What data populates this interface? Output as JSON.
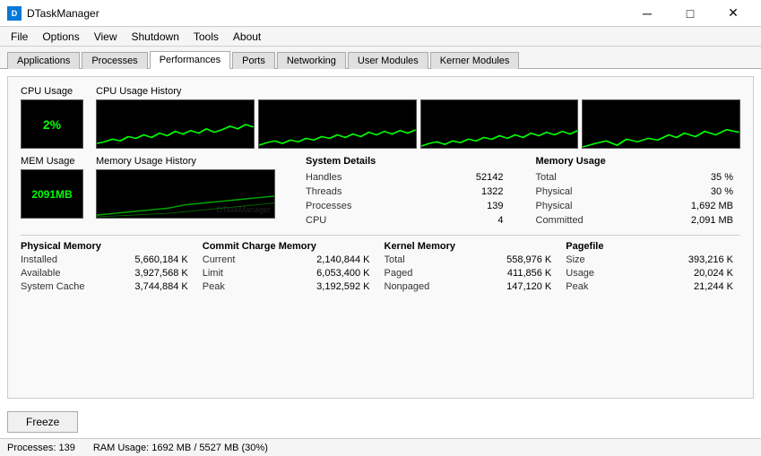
{
  "titlebar": {
    "icon_label": "D",
    "title": "DTaskManager",
    "minimize_label": "─",
    "maximize_label": "□",
    "close_label": "✕"
  },
  "menubar": {
    "items": [
      "File",
      "Options",
      "View",
      "Shutdown",
      "Tools",
      "About"
    ]
  },
  "tabs": {
    "items": [
      "Applications",
      "Processes",
      "Performances",
      "Ports",
      "Networking",
      "User Modules",
      "Kerner Modules"
    ],
    "active": "Performances"
  },
  "cpu": {
    "section_label": "CPU Usage",
    "value": "2%",
    "history_label": "CPU Usage History"
  },
  "mem": {
    "section_label": "MEM Usage",
    "value": "2091MB",
    "history_label": "Memory Usage History"
  },
  "system_details": {
    "title": "System Details",
    "rows": [
      {
        "label": "Handles",
        "value": "52142"
      },
      {
        "label": "Threads",
        "value": "1322"
      },
      {
        "label": "Processes",
        "value": "139"
      },
      {
        "label": "CPU",
        "value": "4"
      }
    ]
  },
  "memory_usage": {
    "title": "Memory Usage",
    "rows": [
      {
        "label": "Total",
        "value": "35 %"
      },
      {
        "label": "Physical",
        "value": "30 %"
      },
      {
        "label": "Physical",
        "value": "1,692 MB"
      },
      {
        "label": "Committed",
        "value": "2,091 MB"
      }
    ]
  },
  "physical_memory": {
    "title": "Physical Memory",
    "rows": [
      {
        "label": "Installed",
        "value": "5,660,184 K"
      },
      {
        "label": "Available",
        "value": "3,927,568 K"
      },
      {
        "label": "System Cache",
        "value": "3,744,884 K"
      }
    ]
  },
  "commit_charge": {
    "title": "Commit Charge Memory",
    "rows": [
      {
        "label": "Current",
        "value": "2,140,844 K"
      },
      {
        "label": "Limit",
        "value": "6,053,400 K"
      },
      {
        "label": "Peak",
        "value": "3,192,592 K"
      }
    ]
  },
  "kernel_memory": {
    "title": "Kernel Memory",
    "rows": [
      {
        "label": "Total",
        "value": "558,976 K"
      },
      {
        "label": "Paged",
        "value": "411,856 K"
      },
      {
        "label": "Nonpaged",
        "value": "147,120 K"
      }
    ]
  },
  "pagefile": {
    "title": "Pagefile",
    "rows": [
      {
        "label": "Size",
        "value": "393,216 K"
      },
      {
        "label": "Usage",
        "value": "20,024 K"
      },
      {
        "label": "Peak",
        "value": "21,244 K"
      }
    ]
  },
  "freeze_button": "Freeze",
  "statusbar": {
    "processes": "Processes: 139",
    "ram": "RAM Usage: 1692 MB / 5527 MB (30%)"
  }
}
